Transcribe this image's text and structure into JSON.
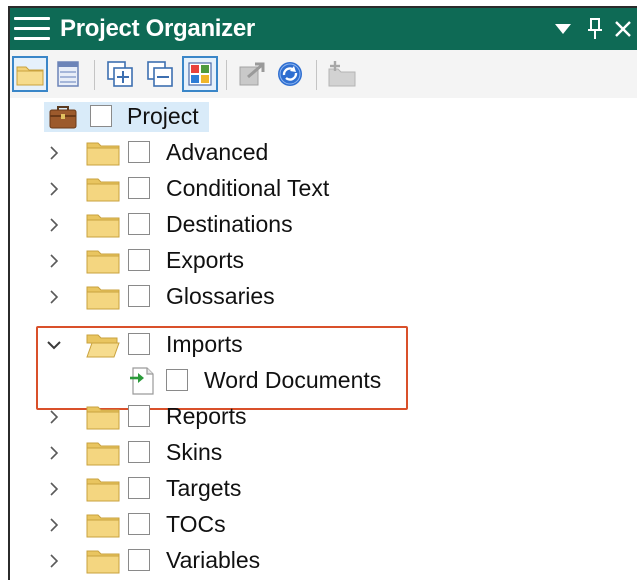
{
  "panel": {
    "title": "Project Organizer",
    "colors": {
      "title_bg": "#0e6a55",
      "highlight_border": "#d9502a",
      "selection_bg": "#d9ebf9",
      "folder": "#f2d27a"
    }
  },
  "titlebar_buttons": [
    {
      "icon": "dropdown-triangle-icon"
    },
    {
      "icon": "pin-icon"
    },
    {
      "icon": "close-icon"
    }
  ],
  "toolbar": [
    {
      "icon": "folder-view-icon",
      "selected": true
    },
    {
      "icon": "list-view-icon",
      "selected": false
    },
    {
      "icon": "expand-all-icon",
      "selected": false
    },
    {
      "icon": "collapse-all-icon",
      "selected": false
    },
    {
      "icon": "show-file-types-icon",
      "selected": true
    },
    {
      "icon": "open-item-icon",
      "selected": false
    },
    {
      "icon": "refresh-icon",
      "selected": false
    },
    {
      "icon": "add-folder-icon",
      "selected": false
    }
  ],
  "tree": {
    "root": {
      "label": "Project",
      "icon": "briefcase-icon"
    },
    "folders": [
      {
        "label": "Advanced",
        "expanded": false
      },
      {
        "label": "Conditional Text",
        "expanded": false
      },
      {
        "label": "Destinations",
        "expanded": false
      },
      {
        "label": "Exports",
        "expanded": false
      },
      {
        "label": "Glossaries",
        "expanded": false
      },
      {
        "label": "Imports",
        "expanded": true,
        "children": [
          {
            "label": "Word Documents",
            "icon": "import-file-icon"
          }
        ]
      },
      {
        "label": "Reports",
        "expanded": false
      },
      {
        "label": "Skins",
        "expanded": false
      },
      {
        "label": "Targets",
        "expanded": false
      },
      {
        "label": "TOCs",
        "expanded": false
      },
      {
        "label": "Variables",
        "expanded": false
      }
    ]
  }
}
